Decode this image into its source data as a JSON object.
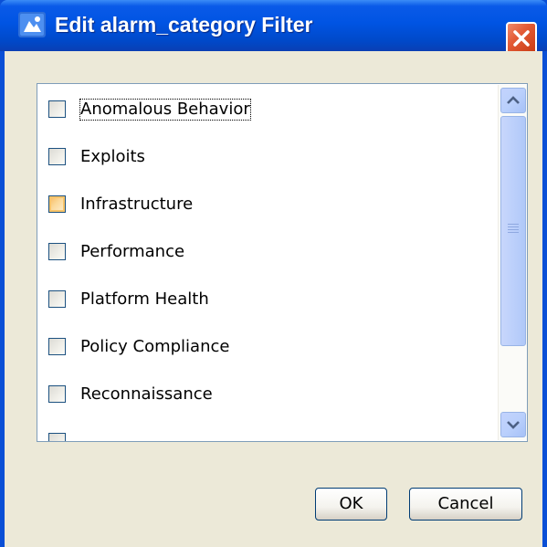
{
  "window": {
    "title": "Edit alarm_category Filter",
    "icon": "app-icon",
    "close_icon": "close-icon"
  },
  "list": {
    "items": [
      {
        "label": "Anomalous Behavior",
        "checked": false,
        "state": "focused"
      },
      {
        "label": "Exploits",
        "checked": false,
        "state": "normal"
      },
      {
        "label": "Infrastructure",
        "checked": false,
        "state": "hover"
      },
      {
        "label": "Performance",
        "checked": false,
        "state": "normal"
      },
      {
        "label": "Platform Health",
        "checked": false,
        "state": "normal"
      },
      {
        "label": "Policy Compliance",
        "checked": false,
        "state": "normal"
      },
      {
        "label": "Reconnaissance",
        "checked": false,
        "state": "normal"
      }
    ]
  },
  "buttons": {
    "ok": "OK",
    "cancel": "Cancel"
  },
  "colors": {
    "titlebar": "#0054e3",
    "client_background": "#ece9d8",
    "close_button": "#e35b36"
  }
}
